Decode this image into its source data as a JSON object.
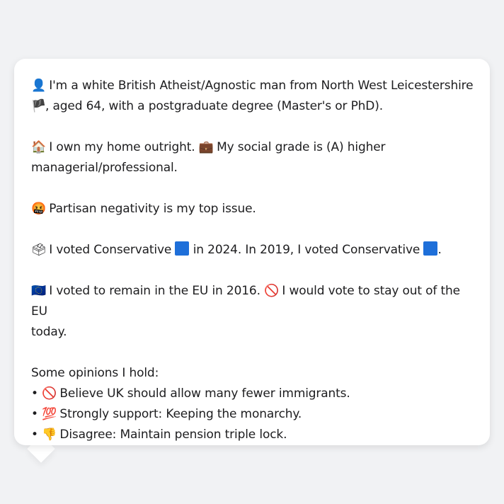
{
  "intro": {
    "line1_pre": "I'm a white British Atheist/Agnostic man from North West Leicestershire",
    "line2": ", aged 64, with a postgraduate degree (Master's or PhD).",
    "person_icon": "👤",
    "flag_icon": "🏴"
  },
  "home": {
    "house_icon": "🏠",
    "own_text": "I own my home outright.",
    "briefcase_icon": "💼",
    "grade_text": "My social grade is (A) higher",
    "grade_text2": "managerial/professional."
  },
  "issue": {
    "icon": "🤬",
    "text": "Partisan negativity is my top issue."
  },
  "vote": {
    "ballot_icon": "🗳",
    "text_a": "I voted Conservative",
    "text_b": "in 2024. In 2019, I voted Conservative",
    "text_c": ".",
    "party_color": "#1e6fd9"
  },
  "eu": {
    "flag_icon": "🇪🇺",
    "text_a": "I voted to remain in the EU in 2016.",
    "no_icon": "🚫",
    "text_b": "I would vote to stay out of the EU",
    "text_c": "today."
  },
  "opinions": {
    "heading": "Some opinions I hold:",
    "bullet": "•",
    "items": [
      {
        "icon": "🚫",
        "text": "Believe UK should allow many fewer immigrants."
      },
      {
        "icon": "💯",
        "text": "Strongly support: Keeping the monarchy."
      },
      {
        "icon": "👎",
        "text": "Disagree: Maintain pension triple lock."
      }
    ]
  }
}
